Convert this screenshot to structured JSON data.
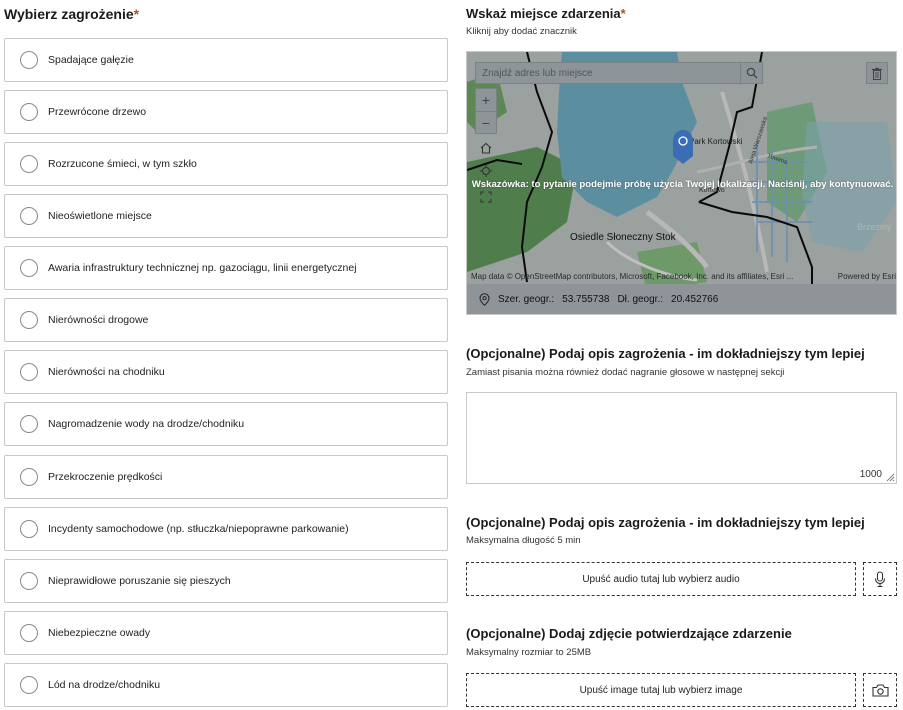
{
  "threat_question": {
    "title": "Wybierz zagrożenie",
    "required_mark": "*",
    "options": [
      "Spadające gałęzie",
      "Przewrócone drzewo",
      "Rozrzucone śmieci, w tym szkło",
      "Nieoświetlone miejsce",
      "Awaria infrastruktury technicznej np. gazociągu, linii energetycznej",
      "Nierówności drogowe",
      "Nierówności na chodniku",
      "Nagromadzenie wody na drodze/chodniku",
      "Przekroczenie prędkości",
      "Incydenty samochodowe (np. stłuczka/niepoprawne parkowanie)",
      "Nieprawidłowe poruszanie się pieszych",
      "Niebezpieczne owady",
      "Lód na drodze/chodniku"
    ]
  },
  "location": {
    "title": "Wskaż miejsce zdarzenia",
    "required_mark": "*",
    "subtitle": "Kliknij aby dodać znacznik",
    "search_placeholder": "Znajdź adres lub miejsce",
    "hint": "Wskazówka: to pytanie podejmie próbę użycia Twojej lokalizacji. Naciśnij, aby kontynuować.",
    "map_labels": {
      "park": "Park Kortowski",
      "district": "Osiedle Słoneczny Stok",
      "kortowo": "Kortowo",
      "brzeziny": "Brzeziny",
      "street1": "Aleja Warszawska",
      "street2": "Tuwima"
    },
    "attribution_left": "Map data © OpenStreetMap contributors, Microsoft, Facebook, Inc. and its affiliates, Esri ...",
    "attribution_right": "Powered by Esri",
    "lat_label": "Szer. geogr.:",
    "lat_value": "53.755738",
    "lon_label": "Dł. geogr.:",
    "lon_value": "20.452766"
  },
  "description": {
    "title": "(Opcjonalne) Podaj opis zagrożenia - im dokładniejszy tym lepiej",
    "subtitle": "Zamiast pisania można również dodać nagranie głosowe w następnej sekcji",
    "char_limit": "1000"
  },
  "audio": {
    "title": "(Opcjonalne) Podaj opis zagrożenia - im dokładniejszy tym lepiej",
    "subtitle": "Maksymalna długość 5 min",
    "drop_label": "Upuść audio tutaj lub wybierz audio"
  },
  "photo": {
    "title": "(Opcjonalne) Dodaj zdjęcie potwierdzające zdarzenie",
    "subtitle": "Maksymalny rozmiar to 25MB",
    "drop_label": "Upuść image tutaj lub wybierz image"
  },
  "colors": {
    "required": "#b5501c",
    "map_water": "#5b8fa0",
    "map_marker": "#3b6db5"
  }
}
